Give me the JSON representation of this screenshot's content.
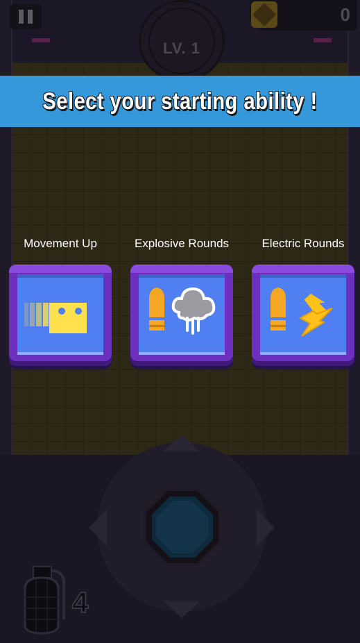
{
  "hud": {
    "level_label": "LV. 1",
    "score_value": "0",
    "pause_icon": "pause-icon",
    "score_icon": "gem-face-icon"
  },
  "banner": {
    "title": "Select your starting ability !"
  },
  "abilities": [
    {
      "label": "Movement Up",
      "icon": "dash-cube-icon"
    },
    {
      "label": "Explosive Rounds",
      "icon": "bullet-cloud-icon"
    },
    {
      "label": "Electric Rounds",
      "icon": "bullet-lightning-icon"
    }
  ],
  "controls": {
    "joystick_icon": "joystick-icon",
    "grenade_icon": "grenade-icon",
    "grenade_count": "4"
  },
  "colors": {
    "banner": "#3498db",
    "card_frame": "#6c2fc0",
    "card_inner": "#4f7ff0",
    "bullet": "#f5a623",
    "lightning": "#ffc21a",
    "cube": "#ffe14d"
  }
}
